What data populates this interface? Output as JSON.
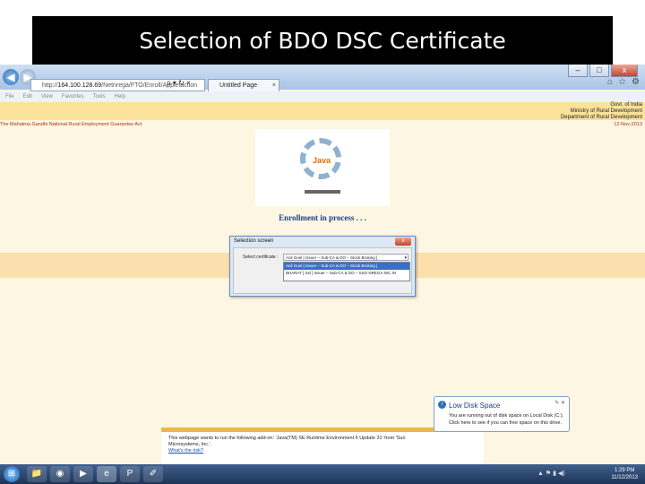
{
  "slide": {
    "title": "Selection of BDO DSC Certificate"
  },
  "browser": {
    "address_prefix": "http://",
    "address_host": "164.100.128.69",
    "address_path": "/Netnrega/FTO/Enroll/Appletaction",
    "address_controls": "ρ ▾ ↻ ×",
    "tab_label": "Untitled Page",
    "tab_close": "×",
    "menu": [
      "File",
      "Edit",
      "View",
      "Favorites",
      "Tools",
      "Help"
    ],
    "window_controls": [
      "–",
      "□",
      "x"
    ],
    "right_icons": [
      "⌂",
      "☆",
      "⚙"
    ]
  },
  "header": {
    "govt_lines": [
      "Govt. of India",
      "Ministry of Rural Development",
      "Department of Rural Development"
    ],
    "act_name": "The Mahatma Gandhi National Rural Employment Guarantee Act",
    "date": "12-Nov-2013"
  },
  "logo": {
    "label": "Java"
  },
  "status": {
    "enrollment": "Enrollment in process . . ."
  },
  "dialog": {
    "title": "Selection screen",
    "close": "x",
    "select_label": "Select certificate :",
    "selected_value": "Anil Goel [ Issuer – Sub-CA & DO – Stock Broking ]",
    "options": [
      "Anil Goel [ Issuer – Sub-CA & DO – Stock Broking ]",
      "BHARAT [ Ssl ] Issuer – Sub-CA & DO – SSO NREGA.NIC.IN"
    ],
    "dropdown_arrow": "▾"
  },
  "infobar": {
    "message": "This webpage wants to run the following add-on: 'Java(TM) SE Runtime Environment 6 Update 31' from 'Sun Microsystems, Inc.'.",
    "link": "What's the risk?"
  },
  "balloon": {
    "title": "Low Disk Space",
    "message": "You are running out of disk space on Local Disk (C:). Click here to see if you can free space on this drive.",
    "controls": "✎ ✕"
  },
  "taskbar": {
    "start": "⊞",
    "apps": [
      "📁",
      "◉",
      "▶",
      "e",
      "P",
      "✐"
    ],
    "tray": "▲ ⚑ ▮ ◀)",
    "time": "1:29 PM",
    "date": "11/12/2013"
  }
}
